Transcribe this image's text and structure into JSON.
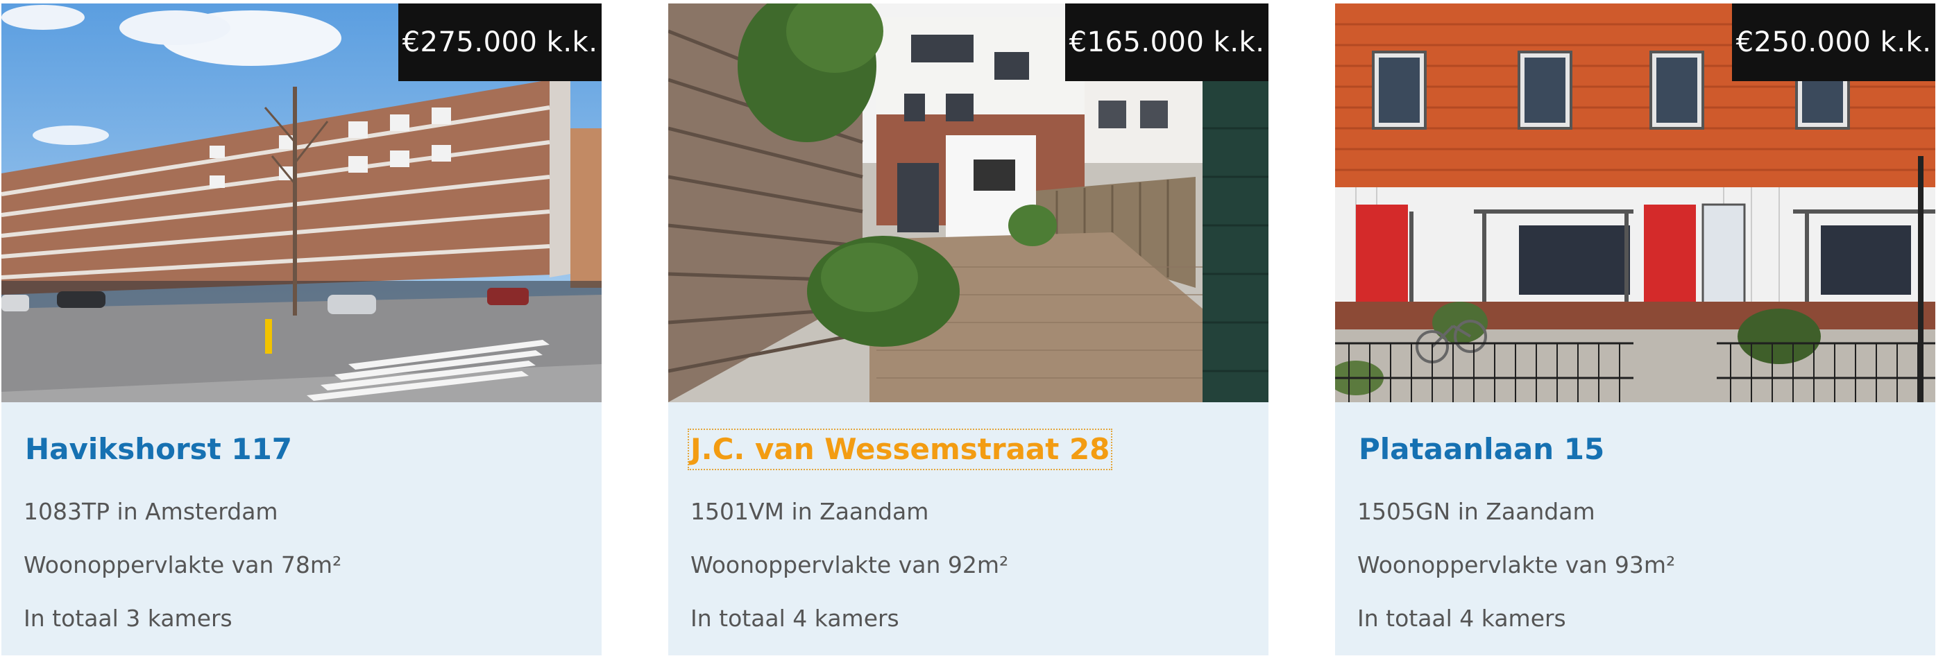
{
  "listings": [
    {
      "price": "€275.000 k.k.",
      "title": "Havikshorst 117",
      "location": "1083TP in Amsterdam",
      "area": "Woonoppervlakte van 78m²",
      "rooms": "In totaal 3 kamers"
    },
    {
      "price": "€165.000 k.k.",
      "title": "J.C. van Wessemstraat 28",
      "location": "1501VM in Zaandam",
      "area": "Woonoppervlakte van 92m²",
      "rooms": "In totaal 4 kamers"
    },
    {
      "price": "€250.000 k.k.",
      "title": "Plataanlaan 15",
      "location": "1505GN in Zaandam",
      "area": "Woonoppervlakte van 93m²",
      "rooms": "In totaal 4 kamers"
    }
  ],
  "colors": {
    "card_bg": "#e6f0f7",
    "title_link": "#1671b2",
    "title_hover": "#f39c12",
    "price_bg": "#111111",
    "body_text": "#555555"
  }
}
